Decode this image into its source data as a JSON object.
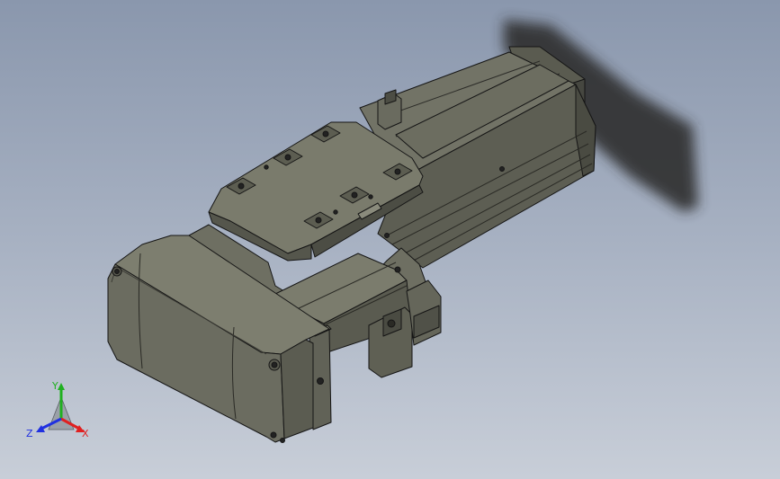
{
  "view": {
    "triad": {
      "x_label": "X",
      "y_label": "Y",
      "z_label": "Z",
      "x_color": "#e02020",
      "y_color": "#20b020",
      "z_color": "#2030e0"
    },
    "model_icon": "linear-actuator-model",
    "background_top": "#8a97ad",
    "background_bottom": "#c8ced8"
  }
}
